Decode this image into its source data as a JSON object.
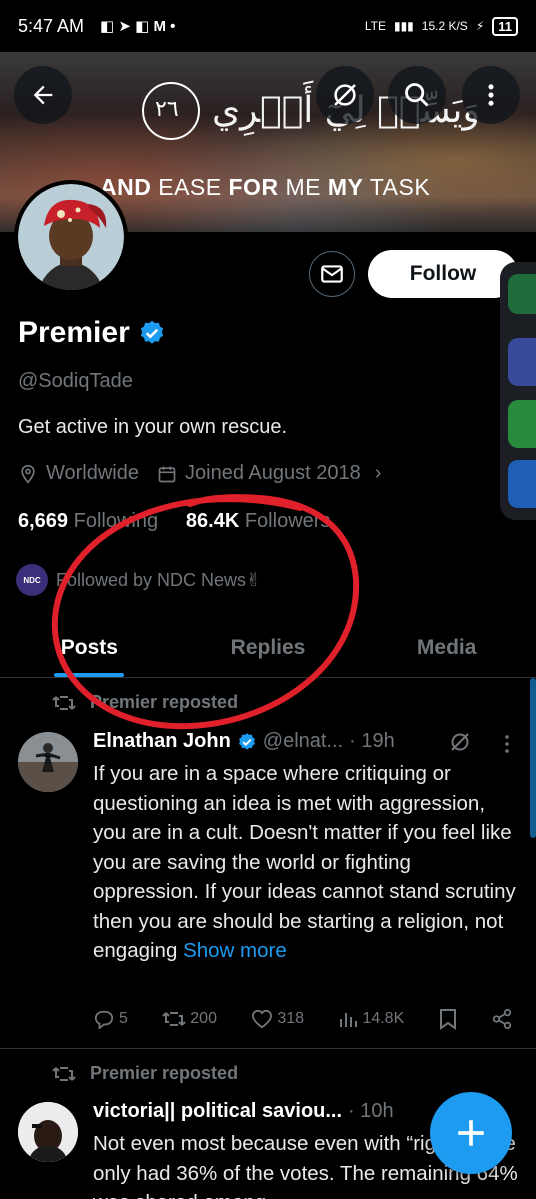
{
  "status_bar": {
    "time": "5:47 AM",
    "icons": "◧ ➤ ◧ M •",
    "network": "LTE",
    "signal": "▮▮▮",
    "speed": "15.2 K/S",
    "battery": "11"
  },
  "banner": {
    "arabic_text": "وَيَسِّرۡ لِيٓ أَمۡرِي",
    "verse_number": "٢٦",
    "caption_part1": "AND",
    "caption_part2": " EASE ",
    "caption_part3": "FOR",
    "caption_part4": " ME ",
    "caption_part5": "MY",
    "caption_part6": " TASK"
  },
  "profile": {
    "follow_label": "Follow",
    "name": "Premier",
    "handle": "@SodiqTade",
    "bio": "Get active in your own rescue.",
    "location": "Worldwide",
    "joined": "Joined August 2018",
    "following_count": "6,669",
    "following_label": "Following",
    "followers_count": "86.4K",
    "followers_label": "Followers",
    "followed_by": "Followed by NDC News✌",
    "ndc_badge": "NDC"
  },
  "tabs": [
    {
      "label": "Posts"
    },
    {
      "label": "Replies"
    },
    {
      "label": "Media"
    }
  ],
  "posts": [
    {
      "repost_label": "Premier reposted",
      "author_name": "Elnathan John",
      "author_handle": "@elnat...",
      "time": "· 19h",
      "text": "If you are in a space where critiquing or questioning an idea is met with aggression, you are in a cult. Doesn't matter if you feel like you are saving the world or fighting  oppression. If your ideas cannot stand scrutiny then you are should be starting a religion, not engaging ",
      "show_more": "Show more",
      "replies": "5",
      "reposts": "200",
      "likes": "318",
      "views": "14.8K"
    },
    {
      "repost_label": "Premier reposted",
      "author_name": "victoria|| political saviou...",
      "time": "· 10h",
      "text": "Not even most because even with “rigging”, he only had 36% of the votes. The remaining 64% was shared among"
    }
  ],
  "colors": {
    "accent": "#1d9bf0",
    "background": "#000000",
    "annotation": "#e0202a"
  }
}
